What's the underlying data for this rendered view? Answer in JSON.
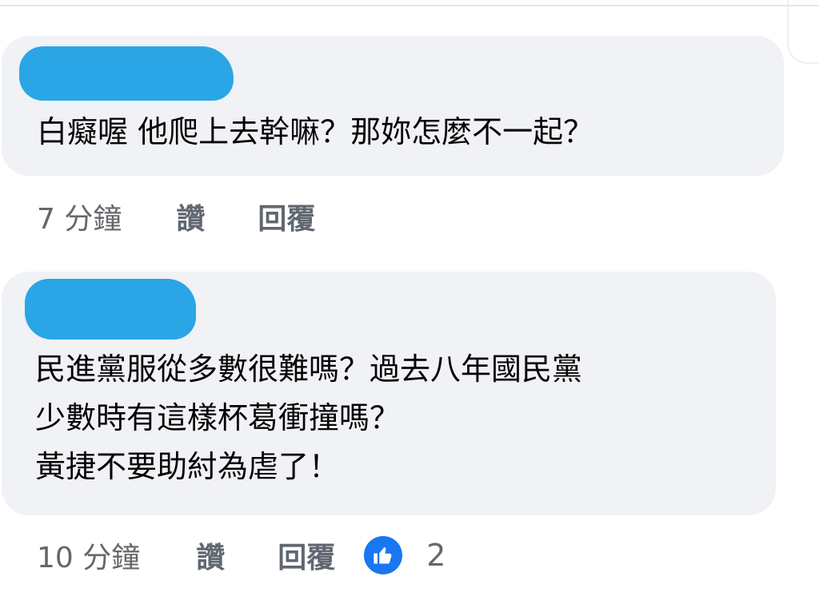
{
  "comments": [
    {
      "author": "",
      "text": "白癡喔 他爬上去幹嘛？那妳怎麼不一起？",
      "time": "7 分鐘",
      "like_label": "讚",
      "reply_label": "回覆"
    },
    {
      "author": "",
      "text_lines": [
        "民進黨服從多數很難嗎？過去八年國民黨",
        "少數時有這樣杯葛衝撞嗎？",
        "黃捷不要助紂為虐了！"
      ],
      "time": "10 分鐘",
      "like_label": "讚",
      "reply_label": "回覆",
      "reaction_count": "2",
      "reaction_icon": "thumbs-up-icon"
    }
  ],
  "colors": {
    "bubble": "#f0f2f5",
    "meta_text": "#65676b",
    "reaction_blue": "#1877f2",
    "redaction": "#2aa6e6"
  }
}
